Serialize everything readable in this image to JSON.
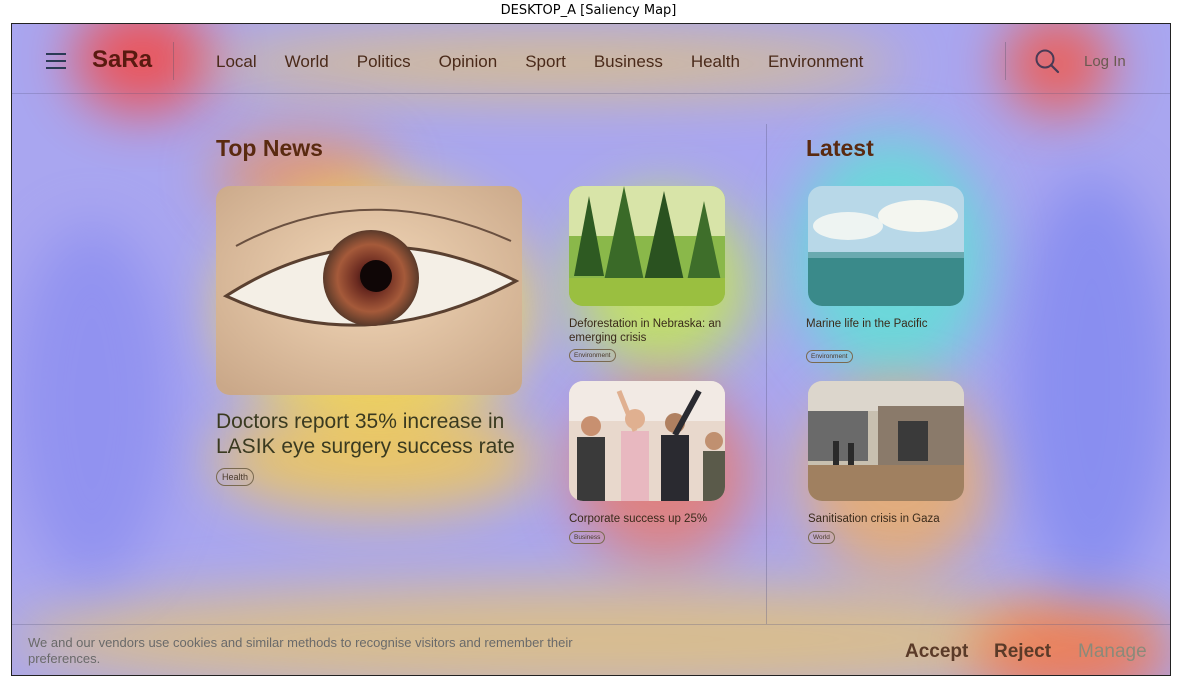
{
  "caption": "DESKTOP_A [Saliency Map]",
  "header": {
    "logo": "SaRa",
    "nav": [
      "Local",
      "World",
      "Politics",
      "Opinion",
      "Sport",
      "Business",
      "Health",
      "Environment"
    ],
    "login": "Log In"
  },
  "top_news": {
    "title": "Top News",
    "main_story": {
      "headline": "Doctors report 35% increase in LASIK eye surgery success rate",
      "tag": "Health"
    },
    "stories": [
      {
        "headline": "Deforestation in Nebraska: an emerging crisis",
        "tag": "Environment"
      },
      {
        "headline": "Corporate success up 25%",
        "tag": "Business"
      }
    ]
  },
  "latest": {
    "title": "Latest",
    "stories": [
      {
        "headline": "Marine life in the Pacific",
        "tag": "Environment"
      },
      {
        "headline": "Sanitisation crisis in Gaza",
        "tag": "World"
      }
    ]
  },
  "cookie": {
    "text": "We and our vendors use cookies and similar methods to recognise visitors and remember their preferences.",
    "accept": "Accept",
    "reject": "Reject",
    "manage": "Manage"
  },
  "icons": [
    "hamburger-menu-icon",
    "search-icon"
  ]
}
